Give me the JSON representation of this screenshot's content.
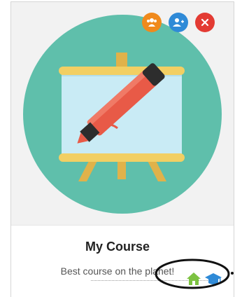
{
  "card": {
    "title": "My Course",
    "subtitle": "Best course on the planet!"
  },
  "actions": [
    {
      "name": "participants",
      "icon": "users-icon",
      "color": "#f08a1c"
    },
    {
      "name": "add-user",
      "icon": "add-user-icon",
      "color": "#2f8ad7"
    },
    {
      "name": "close",
      "icon": "close-icon",
      "color": "#e33b33"
    }
  ],
  "footer_icons": [
    {
      "icon": "home-icon",
      "color": "#7cc241"
    },
    {
      "icon": "graduation-cap-icon",
      "color": "#2f8ad7"
    }
  ],
  "illustration": {
    "circle_color": "#5fbfab",
    "board_color": "#c9ebf5",
    "frame_color": "#f2cf63",
    "marker_color": "#e85a47"
  }
}
